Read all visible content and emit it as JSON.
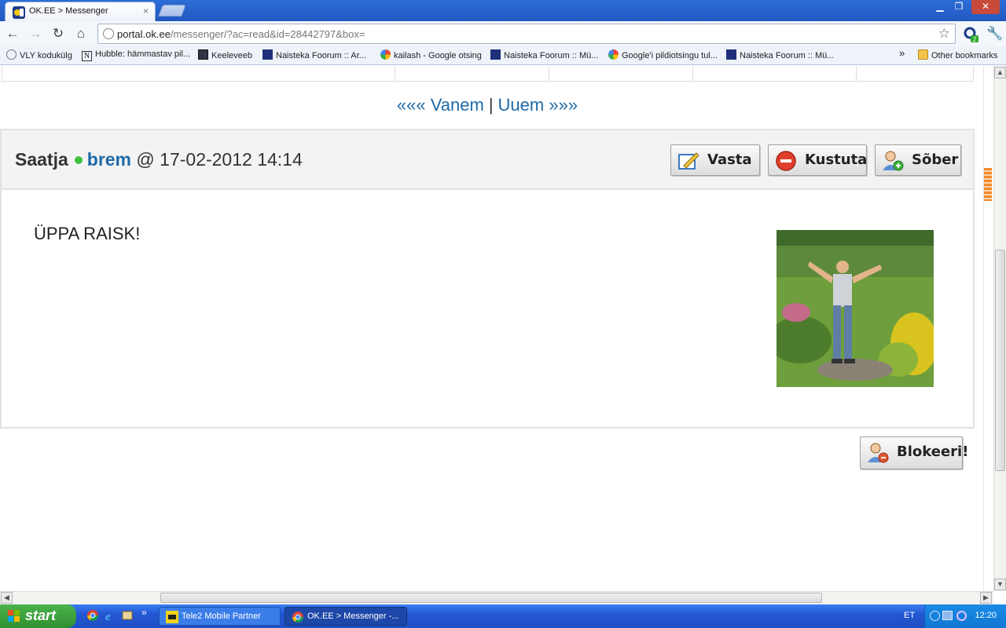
{
  "browser": {
    "tab_title": "OK.EE > Messenger",
    "tab_close": "×",
    "url_domain": "portal.ok.ee",
    "url_path": "/messenger/?ac=read&id=28442797&box=",
    "extension_badge": "2"
  },
  "bookmarks": [
    {
      "label": "VLY kodukülg",
      "icon": "globe-icon"
    },
    {
      "label": "Hubble: hämmastav pil...",
      "icon": "n-icon"
    },
    {
      "label": "Keeleveeb",
      "icon": "monitor-icon"
    },
    {
      "label": "Naisteka Foorum :: Ar...",
      "icon": "naisteka-icon"
    },
    {
      "label": "kailash - Google otsing",
      "icon": "google-icon"
    },
    {
      "label": "Naisteka Foorum :: Mü...",
      "icon": "naisteka-icon"
    },
    {
      "label": "Google'i pildiotsingu tul...",
      "icon": "google-icon"
    },
    {
      "label": "Naisteka Foorum :: Mü...",
      "icon": "naisteka-icon"
    }
  ],
  "bookmarks_overflow": "»",
  "other_bookmarks": "Other bookmarks",
  "pager": {
    "older": "««« Vanem",
    "separator": "|",
    "newer": "Uuem »»»"
  },
  "message": {
    "sender_label": "Saatja",
    "sender": "brem",
    "at": "@",
    "datetime": "17-02-2012 14:14",
    "body": "ÜPPA RAISK!",
    "online_color": "#3ec13e"
  },
  "actions": {
    "reply": "Vasta",
    "delete": "Kustuta",
    "friend": "Sõber",
    "block": "Blokeeri!"
  },
  "taskbar": {
    "start": "start",
    "tasks": [
      "Tele2 Mobile Partner",
      "OK.EE > Messenger -..."
    ],
    "quicklaunch_more": "»",
    "language": "ET",
    "clock": "12:20"
  },
  "colors": {
    "link": "#1e6aa8",
    "accent_blue": "#2158c0"
  }
}
